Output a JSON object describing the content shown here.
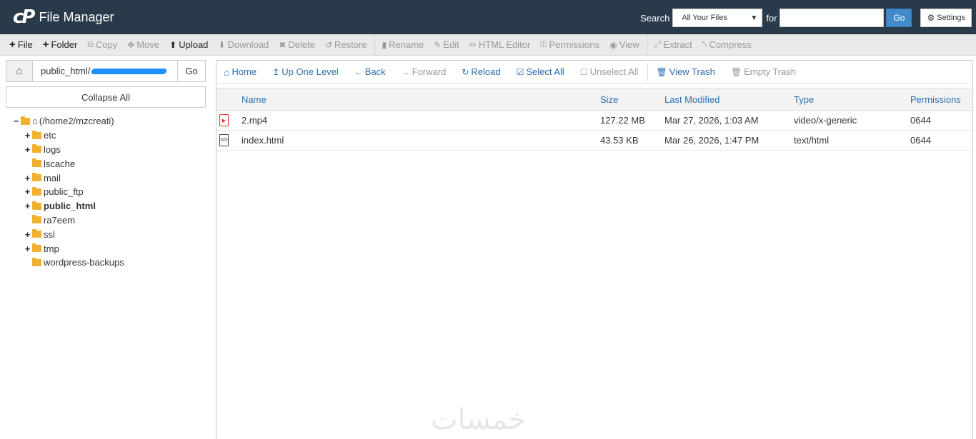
{
  "header": {
    "logo_text": "cP",
    "title": "File Manager",
    "search_label": "Search",
    "search_scope": "All Your Files",
    "for_label": "for",
    "search_value": "",
    "go_label": "Go",
    "settings_label": "Settings"
  },
  "toolbar": {
    "items": [
      {
        "label": "File",
        "icon": "plus-icon",
        "enabled": true
      },
      {
        "label": "Folder",
        "icon": "plus-icon",
        "enabled": true
      },
      {
        "label": "Copy",
        "icon": "copy-icon",
        "enabled": false
      },
      {
        "label": "Move",
        "icon": "move-icon",
        "enabled": false
      },
      {
        "label": "Upload",
        "icon": "upload-icon",
        "enabled": true
      },
      {
        "label": "Download",
        "icon": "download-icon",
        "enabled": false
      },
      {
        "label": "Delete",
        "icon": "delete-icon",
        "enabled": false
      },
      {
        "label": "Restore",
        "icon": "restore-icon",
        "enabled": false
      },
      {
        "label": "Rename",
        "icon": "rename-icon",
        "enabled": false
      },
      {
        "label": "Edit",
        "icon": "pencil-icon",
        "enabled": false
      },
      {
        "label": "HTML Editor",
        "icon": "html-editor-icon",
        "enabled": false
      },
      {
        "label": "Permissions",
        "icon": "key-icon",
        "enabled": false
      },
      {
        "label": "View",
        "icon": "eye-icon",
        "enabled": false
      },
      {
        "label": "Extract",
        "icon": "expand-icon",
        "enabled": false
      },
      {
        "label": "Compress",
        "icon": "compress-icon",
        "enabled": false
      }
    ]
  },
  "left": {
    "path_value": "public_html/",
    "go_label": "Go",
    "collapse_label": "Collapse All",
    "root_label": "(/home2/mzcreati)",
    "tree": [
      {
        "label": "etc",
        "expandable": true,
        "active": false
      },
      {
        "label": "logs",
        "expandable": true,
        "active": false
      },
      {
        "label": "lscache",
        "expandable": false,
        "active": false
      },
      {
        "label": "mail",
        "expandable": true,
        "active": false
      },
      {
        "label": "public_ftp",
        "expandable": true,
        "active": false
      },
      {
        "label": "public_html",
        "expandable": true,
        "active": true
      },
      {
        "label": "ra7eem",
        "expandable": false,
        "active": false
      },
      {
        "label": "ssl",
        "expandable": true,
        "active": false
      },
      {
        "label": "tmp",
        "expandable": true,
        "active": false
      },
      {
        "label": "wordpress-backups",
        "expandable": false,
        "active": false
      }
    ]
  },
  "nav": {
    "home": "Home",
    "up": "Up One Level",
    "back": "Back",
    "forward": "Forward",
    "reload": "Reload",
    "select_all": "Select All",
    "unselect_all": "Unselect All",
    "view_trash": "View Trash",
    "empty_trash": "Empty Trash"
  },
  "table": {
    "headers": {
      "name": "Name",
      "size": "Size",
      "modified": "Last Modified",
      "type": "Type",
      "permissions": "Permissions"
    },
    "rows": [
      {
        "icon": "video-file-icon",
        "name": "2.mp4",
        "size": "127.22 MB",
        "modified": "Mar 27, 2026, 1:03 AM",
        "type": "video/x-generic",
        "permissions": "0644"
      },
      {
        "icon": "html-file-icon",
        "name": "index.html",
        "size": "43.53 KB",
        "modified": "Mar 26, 2026, 1:47 PM",
        "type": "text/html",
        "permissions": "0644"
      }
    ]
  },
  "watermark": "خمسات"
}
